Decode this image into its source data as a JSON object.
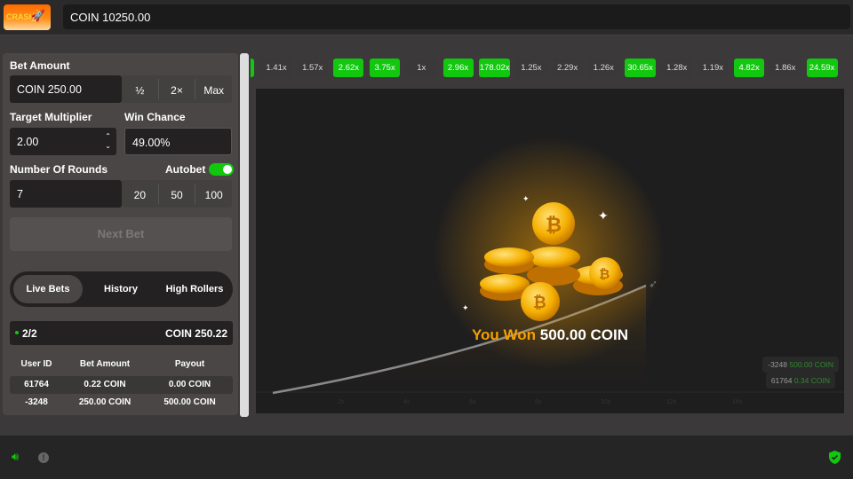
{
  "header": {
    "logo_text": "CRASH",
    "balance": "COIN 10250.00"
  },
  "bet": {
    "label": "Bet Amount",
    "value": "COIN 250.00",
    "half": "½",
    "double": "2×",
    "max": "Max"
  },
  "target": {
    "label": "Target Multiplier",
    "value": "2.00"
  },
  "win_chance": {
    "label": "Win Chance",
    "value": "49.00%"
  },
  "rounds": {
    "label": "Number Of Rounds",
    "value": "7",
    "opts": [
      "20",
      "50",
      "100"
    ],
    "autobet_label": "Autobet",
    "autobet_on": true
  },
  "next_bet": "Next Bet",
  "tabs": [
    "Live Bets",
    "History",
    "High Rollers"
  ],
  "summary": {
    "count": "2/2",
    "total": "COIN 250.22"
  },
  "table": {
    "headers": [
      "User ID",
      "Bet Amount",
      "Payout"
    ],
    "rows": [
      [
        "61764",
        "0.22 COIN",
        "0.00 COIN"
      ],
      [
        "-3248",
        "250.00 COIN",
        "500.00 COIN"
      ]
    ]
  },
  "history": [
    {
      "v": "",
      "g": true
    },
    {
      "v": "1.41x",
      "g": false
    },
    {
      "v": "1.57x",
      "g": false
    },
    {
      "v": "2.62x",
      "g": true
    },
    {
      "v": "3.75x",
      "g": true
    },
    {
      "v": "1x",
      "g": false
    },
    {
      "v": "2.96x",
      "g": true
    },
    {
      "v": "178.02x",
      "g": true
    },
    {
      "v": "1.25x",
      "g": false
    },
    {
      "v": "2.29x",
      "g": false
    },
    {
      "v": "1.26x",
      "g": false
    },
    {
      "v": "30.65x",
      "g": true
    },
    {
      "v": "1.28x",
      "g": false
    },
    {
      "v": "1.19x",
      "g": false
    },
    {
      "v": "4.82x",
      "g": true
    },
    {
      "v": "1.86x",
      "g": false
    },
    {
      "v": "24.59x",
      "g": true
    }
  ],
  "result": {
    "prefix": "You Won",
    "amount": "500.00 COIN"
  },
  "cashouts": [
    {
      "user": "-3248",
      "amount": "500.00 COIN"
    },
    {
      "user": "61764",
      "amount": "0.34 COIN"
    }
  ],
  "axis": [
    "2s",
    "4s",
    "6s",
    "8s",
    "10s",
    "12s",
    "14s"
  ],
  "colors": {
    "green": "#12c80f",
    "gold": "#f5a000"
  }
}
